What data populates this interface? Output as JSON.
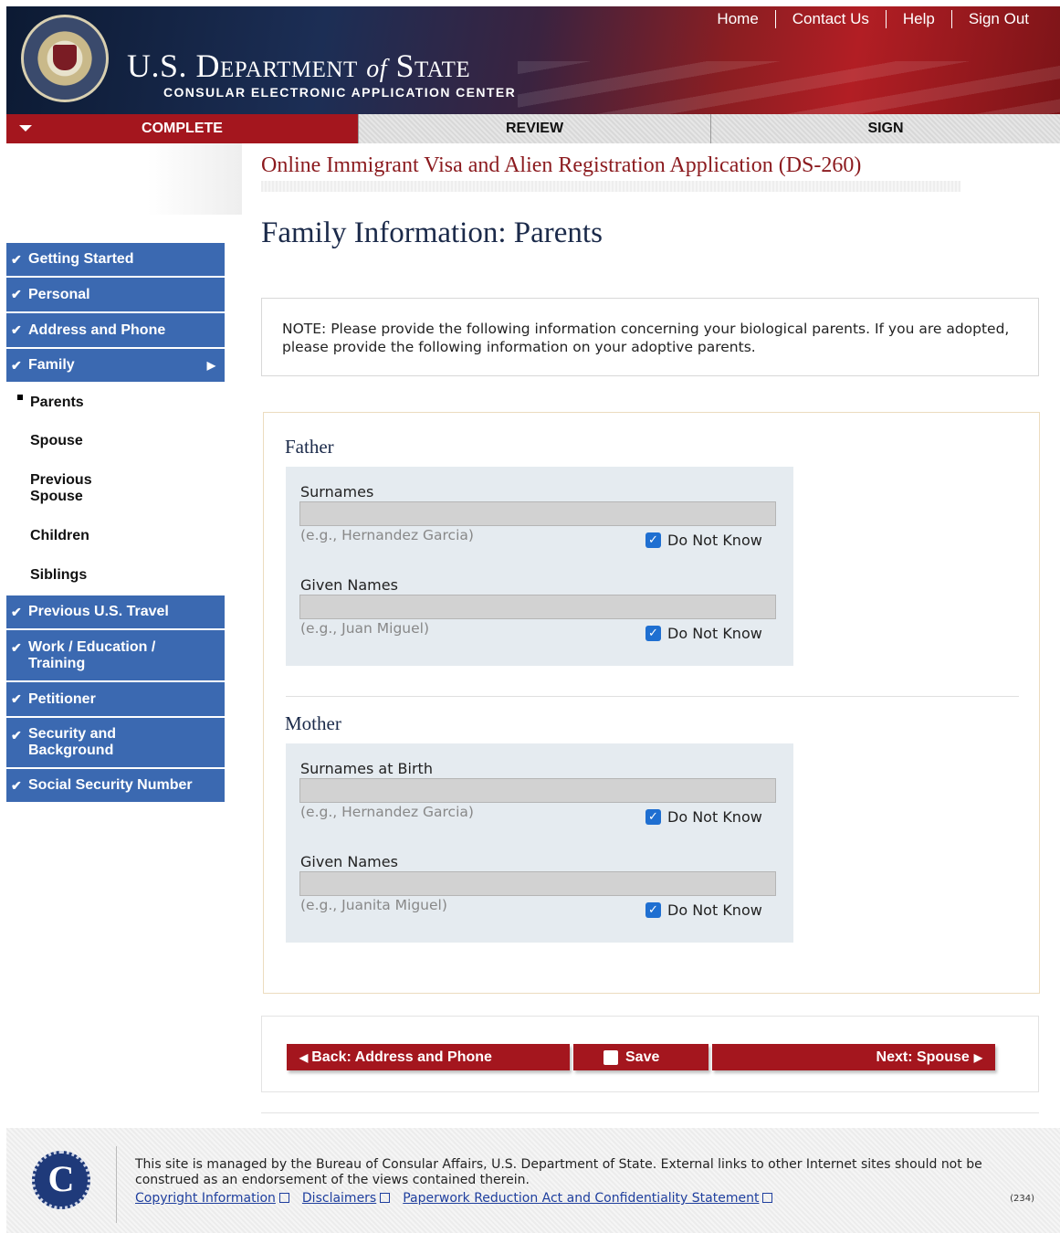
{
  "header": {
    "nav": [
      "Home",
      "Contact Us",
      "Help",
      "Sign Out"
    ],
    "title_main_1": "U.S. Department",
    "title_of": "of",
    "title_main_2": "State",
    "subtitle": "CONSULAR ELECTRONIC APPLICATION CENTER"
  },
  "steps": [
    "COMPLETE",
    "REVIEW",
    "SIGN"
  ],
  "app_title": "Online Immigrant Visa and Alien Registration Application (DS-260)",
  "section_title": "Family Information: Parents",
  "sidebar": {
    "items": [
      {
        "label": "Getting Started"
      },
      {
        "label": "Personal"
      },
      {
        "label": "Address and Phone"
      },
      {
        "label": "Family"
      },
      {
        "label": "Parents"
      },
      {
        "label": "Spouse"
      },
      {
        "label": "Previous Spouse"
      },
      {
        "label": "Children"
      },
      {
        "label": "Siblings"
      },
      {
        "label": "Previous U.S. Travel"
      },
      {
        "label": "Work / Education / Training"
      },
      {
        "label": "Petitioner"
      },
      {
        "label": "Security and Background"
      },
      {
        "label": "Social Security Number"
      }
    ]
  },
  "note": "NOTE: Please provide the following information concerning your biological parents. If you are adopted, please provide the following information on your adoptive parents.",
  "father": {
    "title": "Father",
    "surnames_label": "Surnames",
    "surnames_value": "",
    "surnames_hint": "(e.g., Hernandez Garcia)",
    "given_label": "Given Names",
    "given_value": "",
    "given_hint": "(e.g., Juan Miguel)",
    "dnk": "Do Not Know"
  },
  "mother": {
    "title": "Mother",
    "surnames_label": "Surnames at Birth",
    "surnames_value": "",
    "surnames_hint": "(e.g., Hernandez Garcia)",
    "given_label": "Given Names",
    "given_value": "",
    "given_hint": "(e.g., Juanita Miguel)",
    "dnk": "Do Not Know"
  },
  "buttons": {
    "back": "Back: Address and Phone",
    "save": "Save",
    "next": "Next: Spouse"
  },
  "footer": {
    "text": "This site is managed by the Bureau of Consular Affairs, U.S. Department of State. External links to other Internet sites should not be construed as an endorsement of the views contained therein.",
    "links": [
      "Copyright Information",
      "Disclaimers",
      "Paperwork Reduction Act and Confidentiality Statement"
    ],
    "page_num": "(234)"
  },
  "colors": {
    "nav_blue": "#3b69b1",
    "accent_red": "#a4161e",
    "title_red": "#8b1a1e",
    "checkbox_blue": "#1f6fd1"
  }
}
